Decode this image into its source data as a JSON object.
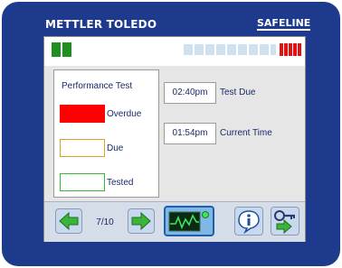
{
  "header": {
    "brand_left": "METTLER TOLEDO",
    "brand_right": "SAFELINE"
  },
  "status_bar": {
    "green_segments": 2,
    "light_segments": 9,
    "red_segments": 5,
    "colors": {
      "green": "#1f8f1f",
      "light": "#cfe0ee",
      "red": "#e01212"
    }
  },
  "legend": {
    "title": "Performance Test",
    "items": [
      {
        "label": "Overdue",
        "color": "#ff0000"
      },
      {
        "label": "Due",
        "color": "#e0a020"
      },
      {
        "label": "Tested",
        "color": "#33bb33"
      }
    ]
  },
  "times": {
    "test_due_value": "02:40pm",
    "test_due_label": "Test Due",
    "current_value": "01:54pm",
    "current_label": "Current Time"
  },
  "toolbar": {
    "page_indicator": "7/10",
    "icons": [
      "arrow-left-icon",
      "arrow-right-icon",
      "waveform-icon",
      "info-icon",
      "key-logout-icon"
    ]
  }
}
